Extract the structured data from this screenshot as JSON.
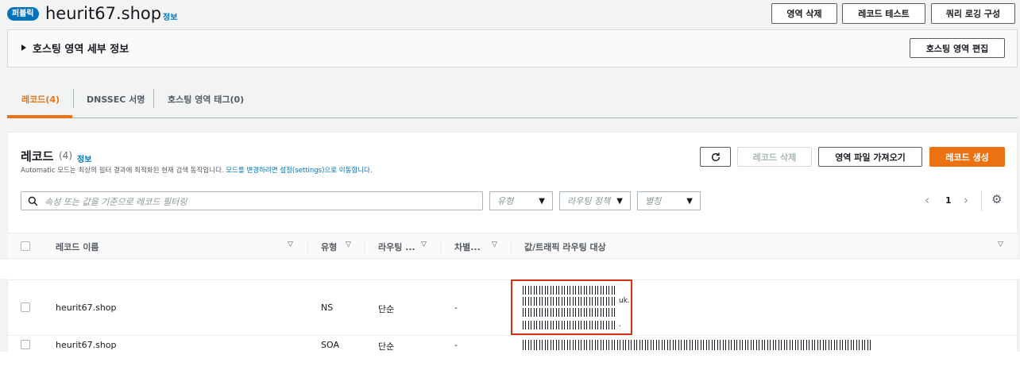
{
  "header": {
    "badge": "퍼블릭",
    "title": "heurit67.shop",
    "info": "정보",
    "buttons": [
      "영역 삭제",
      "레코드 테스트",
      "쿼리 로깅 구성"
    ]
  },
  "details": {
    "title": "호스팅 영역 세부 정보",
    "edit_button": "호스팅 영역 편집"
  },
  "tabs": [
    {
      "label": "레코드(4)",
      "active": true
    },
    {
      "label": "DNSSEC 서명",
      "active": false
    },
    {
      "label": "호스팅 영역 태그(0)",
      "active": false
    }
  ],
  "records": {
    "title": "레코드",
    "count": "(4)",
    "info": "정보",
    "subtitle_prefix": "Automatic 모드는 최상의 필터 결과에 최적화된 현재 검색 동작입니다. ",
    "subtitle_link": "모드를 변경하려면 설정(settings)으로 이동합니다.",
    "actions": {
      "delete": "레코드 삭제",
      "import": "영역 파일 가져오기",
      "create": "레코드 생성"
    },
    "search_placeholder": "속성 또는 값을 기준으로 레코드 필터링",
    "filters": [
      "유형",
      "라우팅 정책",
      "별칭"
    ],
    "page": "1",
    "columns": [
      "레코드 이름",
      "유형",
      "라우팅 ...",
      "차별...",
      "값/트래픽 라우팅 대상"
    ],
    "rows": [
      {
        "name": "heurit67.shop",
        "type": "NS",
        "routing": "단순",
        "diff": "-"
      },
      {
        "name": "heurit67.shop",
        "type": "SOA",
        "routing": "단순",
        "diff": "-"
      }
    ],
    "ns_value_suffixes": [
      "",
      "uk.",
      "",
      "."
    ]
  },
  "icons": {
    "expand": "caret-right-icon",
    "refresh": "refresh-icon",
    "search": "search-icon",
    "prev": "chevron-left-icon",
    "next": "chevron-right-icon",
    "settings": "gear-icon"
  },
  "colors": {
    "accent": "#ec7211",
    "link": "#0073bb",
    "highlight": "#d13212"
  }
}
